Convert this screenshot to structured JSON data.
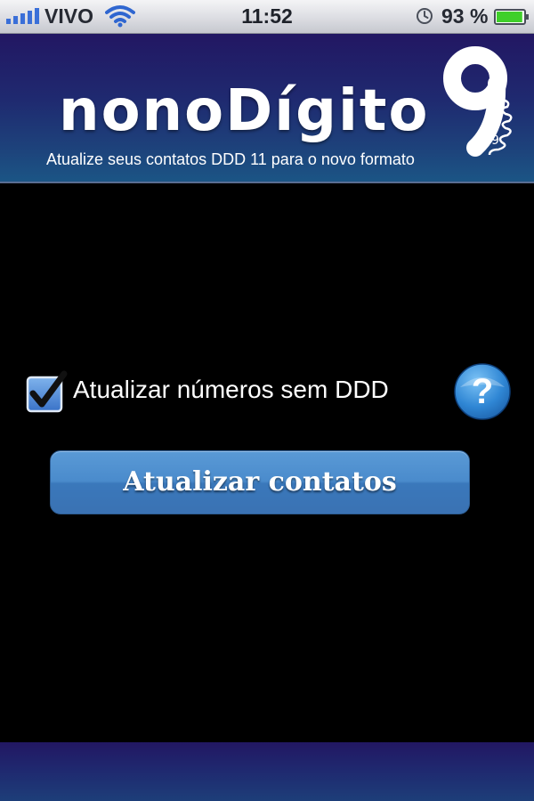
{
  "status_bar": {
    "carrier": "VIVO",
    "time": "11:52",
    "battery_percent": "93 %",
    "battery_level": 0.93,
    "signal_icon": "signal-bars-icon",
    "wifi_icon": "wifi-icon",
    "alarm_icon": "alarm-clock-icon",
    "battery_icon": "battery-icon"
  },
  "header": {
    "logo_text": "nonoDígito",
    "logo_digit": "9",
    "tagline": "Atualize seus contatos DDD 11 para o novo formato"
  },
  "options": {
    "update_without_ddd": {
      "label": "Atualizar números sem DDD",
      "checked": true
    }
  },
  "help": {
    "symbol": "?"
  },
  "actions": {
    "update_contacts_label": "Atualizar contatos"
  },
  "colors": {
    "header_top": "#221763",
    "header_bottom": "#1b5585",
    "button_blue": "#4a8bcc",
    "battery_green": "#3fcf2a",
    "background": "#000000"
  }
}
